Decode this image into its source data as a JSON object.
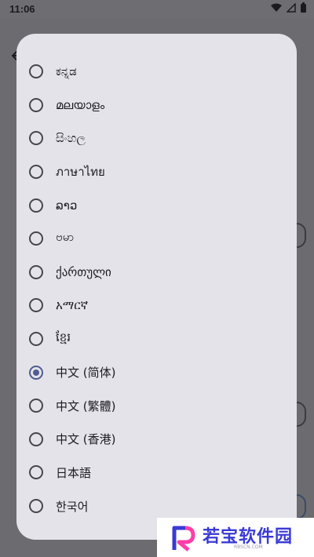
{
  "status_bar": {
    "time": "11:06",
    "icons": [
      "wifi-icon",
      "signal-icon",
      "battery-icon"
    ]
  },
  "dialog": {
    "options": [
      {
        "label": "ಕನ್ನಡ",
        "selected": false
      },
      {
        "label": "മലയാളം",
        "selected": false
      },
      {
        "label": "සිංහල",
        "selected": false
      },
      {
        "label": "ภาษาไทย",
        "selected": false
      },
      {
        "label": "ລາວ",
        "selected": false
      },
      {
        "label": "ဗမာ",
        "selected": false
      },
      {
        "label": "ქართული",
        "selected": false
      },
      {
        "label": "አማርኛ",
        "selected": false
      },
      {
        "label": "ខ្មែរ",
        "selected": false
      },
      {
        "label": "中文 (简体)",
        "selected": true
      },
      {
        "label": "中文 (繁體)",
        "selected": false
      },
      {
        "label": "中文 (香港)",
        "selected": false
      },
      {
        "label": "日本語",
        "selected": false
      },
      {
        "label": "한국어",
        "selected": false
      }
    ]
  },
  "watermark": {
    "text": "若宝软件园",
    "sub": "RBSCN.COM"
  },
  "colors": {
    "scrim": "#6e6e72",
    "dialog_bg": "#e5e3ea",
    "radio_selected": "#4f5d91",
    "watermark_text": "#3a3ad6"
  }
}
